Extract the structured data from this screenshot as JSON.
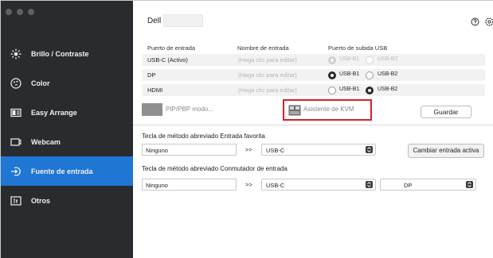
{
  "app": {
    "monitor_name": "Dell"
  },
  "sidebar": {
    "items": [
      {
        "label": "Brillo / Contraste",
        "icon": "sun-icon",
        "active": false
      },
      {
        "label": "Color",
        "icon": "color-icon",
        "active": false
      },
      {
        "label": "Easy Arrange",
        "icon": "arrange-icon",
        "active": false
      },
      {
        "label": "Webcam",
        "icon": "webcam-icon",
        "active": false
      },
      {
        "label": "Fuente de entrada",
        "icon": "input-source-icon",
        "active": true
      },
      {
        "label": "Otros",
        "icon": "others-icon",
        "active": false
      }
    ]
  },
  "inputs_table": {
    "headers": {
      "port": "Puerto de entrada",
      "name": "Nombre de entrada",
      "usb": "Puerto de subida USB"
    },
    "rows": [
      {
        "port": "USB-C (Activo)",
        "name_placeholder": "(Haga clic para editar)",
        "usb_b1": "USB-B1",
        "usb_b2": "USB-B2",
        "selected": "USB-B1",
        "disabled": true
      },
      {
        "port": "DP",
        "name_placeholder": "(Haga clic para editar)",
        "usb_b1": "USB-B1",
        "usb_b2": "USB-B2",
        "selected": "USB-B1",
        "disabled": false
      },
      {
        "port": "HDMI",
        "name_placeholder": "(Haga clic para editar)",
        "usb_b1": "USB-B1",
        "usb_b2": "USB-B2",
        "selected": "USB-B2",
        "disabled": false
      }
    ]
  },
  "tools": {
    "pip_label": "PIP/PBP modo...",
    "kvm_label": "Asistente de KVM",
    "save_label": "Guardar"
  },
  "favorite_input": {
    "title": "Tecla de método abreviado Entrada favorita",
    "shortcut_value": "Ninguno",
    "arrow": ">>",
    "input_value": "USB-C",
    "change_button": "Cambiar entrada activa"
  },
  "switcher": {
    "title": "Tecla de método abreviado Conmutador de entrada",
    "shortcut_value": "Ninguno",
    "arrow": ">>",
    "input_a": "USB-C",
    "swap": "<<>>",
    "input_b": "DP"
  },
  "colors": {
    "sidebar_bg": "#2a2b2e",
    "active_item": "#1f76d3",
    "highlight_outline": "#d81e2c"
  }
}
